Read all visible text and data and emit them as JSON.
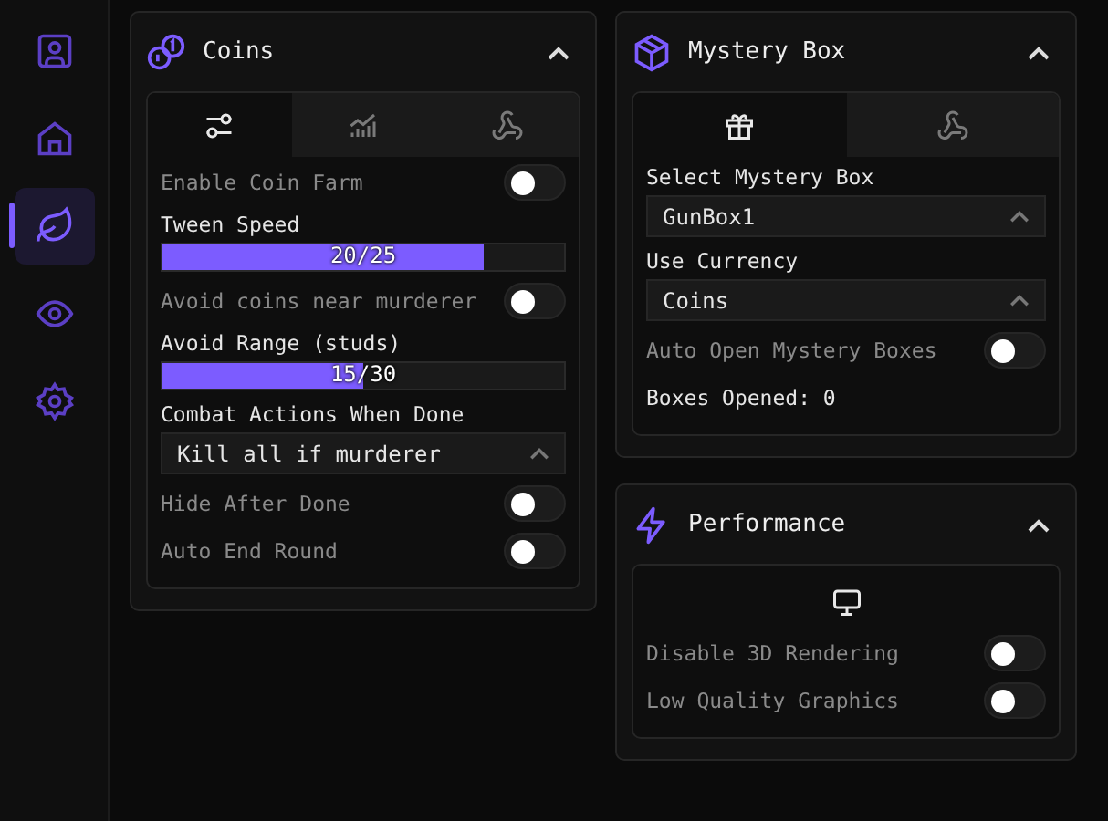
{
  "sidebar": {
    "items": [
      {
        "selected": false
      },
      {
        "selected": false
      },
      {
        "selected": true
      },
      {
        "selected": false
      },
      {
        "selected": false
      }
    ]
  },
  "columns": [
    [
      {
        "title": "Coins",
        "expanded": true,
        "tabs": [
          {
            "selected": true
          },
          {
            "selected": false
          },
          {
            "selected": false
          }
        ],
        "items": [
          {
            "kind": "toggle",
            "label": "Enable Coin Farm",
            "on": false
          },
          {
            "kind": "slider",
            "label": "Tween Speed",
            "level": 0.8,
            "reading": "20/25"
          },
          {
            "kind": "toggle",
            "label": "Avoid coins near murderer",
            "on": false
          },
          {
            "kind": "slider",
            "label": "Avoid Range (studs)",
            "level": 0.5,
            "reading": "15/30"
          },
          {
            "kind": "dropdown",
            "label": "Combat Actions When Done",
            "value": "Kill all if murderer"
          },
          {
            "kind": "toggle",
            "label": "Hide After Done",
            "on": false
          },
          {
            "kind": "toggle",
            "label": "Auto End Round",
            "on": false
          }
        ]
      }
    ],
    [
      {
        "title": "Mystery Box",
        "expanded": true,
        "tabs": [
          {
            "selected": true
          },
          {
            "selected": false
          }
        ],
        "items": [
          {
            "kind": "dropdown",
            "label": "Select Mystery Box",
            "value": "GunBox1"
          },
          {
            "kind": "dropdown",
            "label": "Use Currency",
            "value": "Coins"
          },
          {
            "kind": "toggle",
            "label": "Auto Open Mystery Boxes",
            "on": false
          },
          {
            "kind": "text",
            "label": "Boxes Opened: 0"
          }
        ]
      },
      {
        "title": "Performance",
        "expanded": true,
        "tabs": [
          {
            "selected": true
          }
        ],
        "items": [
          {
            "kind": "toggle",
            "label": "Disable 3D Rendering",
            "on": false
          },
          {
            "kind": "toggle",
            "label": "Low Quality Graphics",
            "on": false
          }
        ]
      }
    ]
  ]
}
